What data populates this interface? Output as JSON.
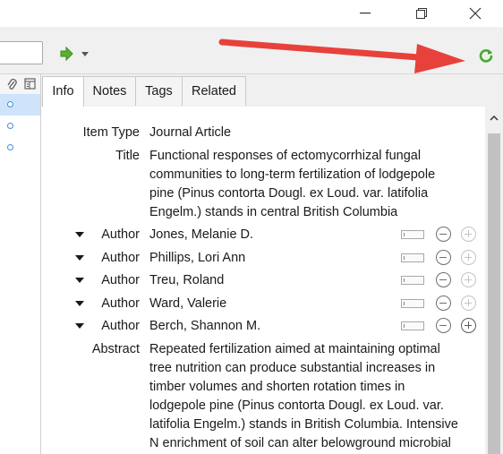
{
  "colors": {
    "accent_arrow": "#e8413c",
    "sync_green": "#4aa33c",
    "selection": "#cfe4fb",
    "dot_blue": "#3d8fd9"
  },
  "toolbar": {
    "locate_icon": "green-right-arrow-icon",
    "sync_icon": "sync-refresh-icon"
  },
  "tabs": [
    {
      "label": "Info",
      "active": true
    },
    {
      "label": "Notes",
      "active": false
    },
    {
      "label": "Tags",
      "active": false
    },
    {
      "label": "Related",
      "active": false
    }
  ],
  "info": {
    "item_type_label": "Item Type",
    "item_type_value": "Journal Article",
    "title_label": "Title",
    "title_value": "Functional responses of ectomycorrhizal fungal communities to long-term fertilization of lodgepole pine (Pinus contorta Dougl. ex Loud. var. latifolia Engelm.) stands in central British Columbia",
    "author_label": "Author",
    "authors": [
      "Jones, Melanie D.",
      "Phillips, Lori Ann",
      "Treu, Roland",
      "Ward, Valerie",
      "Berch, Shannon M."
    ],
    "abstract_label": "Abstract",
    "abstract_value": "Repeated fertilization aimed at maintaining optimal tree nutrition can produce substantial increases in timber volumes and shorten rotation times in lodgepole pine (Pinus contorta Dougl. ex Loud. var. latifolia Engelm.) stands in British Columbia. Intensive N enrichment of soil can alter belowground microbial"
  }
}
